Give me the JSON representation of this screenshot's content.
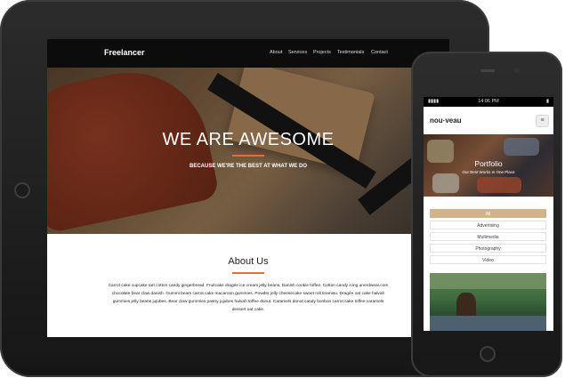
{
  "tablet": {
    "nav": {
      "brand": "Freelancer",
      "links": [
        "About",
        "Services",
        "Projects",
        "Testimonials",
        "Contact"
      ]
    },
    "hero": {
      "title": "WE ARE AWESOME",
      "subtitle": "BECAUSE WE'RE THE BEST AT WHAT WE DO"
    },
    "about": {
      "title": "About Us",
      "text": "Carrot cake cupcake tart cotton candy gingerbread. Fruitcake dragée ice cream jelly beans. Danish cookie toffee. Cotton candy icing unerdwear.com chocolate bear claw danish. Gummi bears carrot cake macaroon gummies. Powder jelly cheesecake sweet roll tiramisu. Dragée oat cake halvah gummies jelly beans jujubes. Bear claw gummies pastry jujubes halvah toffee donut. Caramels donut candy bonbon carrot cake toffee caramels dessert oat cake."
    }
  },
  "phone": {
    "status": {
      "left": "▮▮▮▮",
      "time": "14:06 PM",
      "right": "▮"
    },
    "brand": "nou·veau",
    "menu_icon": "hamburger-icon",
    "hero": {
      "title": "Portfolio",
      "subtitle": "Our Best Works In One Place"
    },
    "filters": [
      "All",
      "Advertising",
      "Multimedia",
      "Photography",
      "Video"
    ],
    "active_filter": "All"
  },
  "colors": {
    "accent": "#e0703a",
    "filter_active": "#d2b48c",
    "nav_bg": "#0c0c0c"
  }
}
